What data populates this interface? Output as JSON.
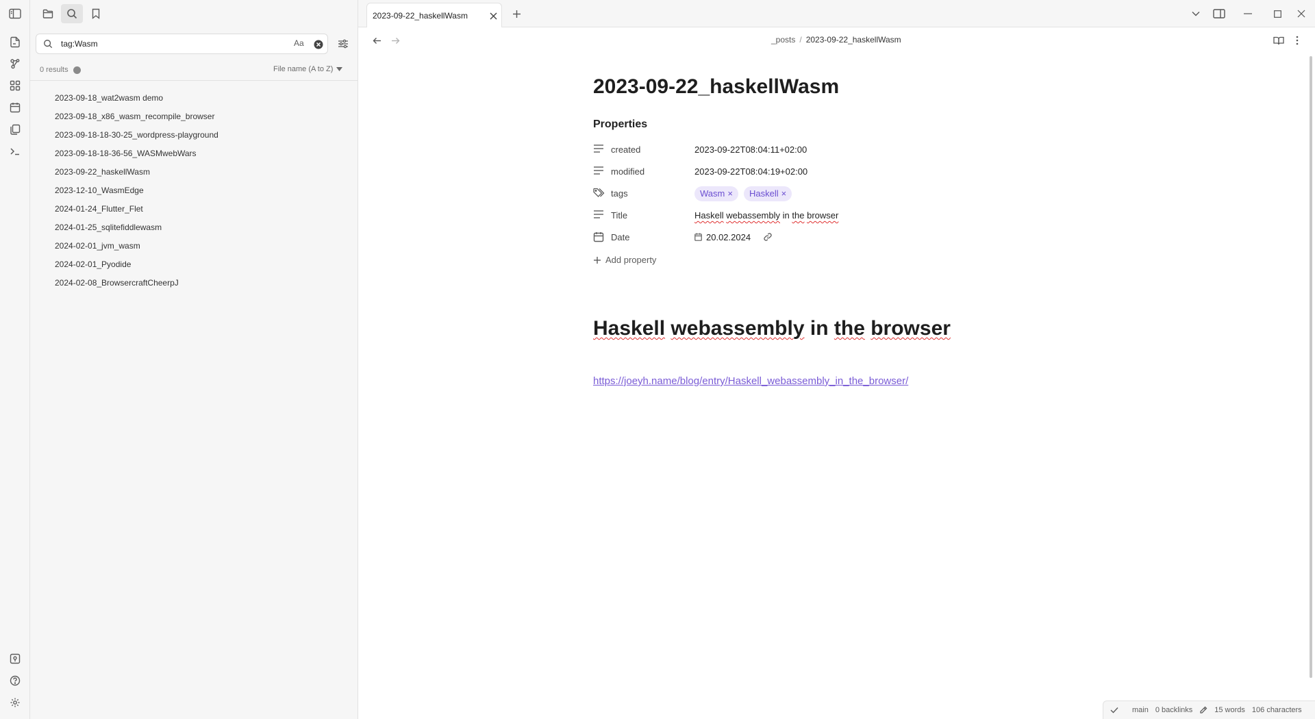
{
  "ribbon": {
    "icons": [
      "sidebar-toggle-icon",
      "new-note-icon",
      "graph-view-icon",
      "canvas-icon",
      "daily-note-icon",
      "templates-icon",
      "command-palette-icon"
    ],
    "bottom_icons": [
      "vault-switcher-icon",
      "help-icon",
      "settings-icon"
    ]
  },
  "sidebar": {
    "tabs": [
      "files-icon",
      "search-icon",
      "bookmarks-icon"
    ],
    "active_tab": "search",
    "search": {
      "query": "tag:Wasm",
      "match_case_label": "Aa"
    },
    "results_count": "0 results",
    "sort_label": "File name (A to Z)",
    "files": [
      "2023-09-18_wat2wasm demo",
      "2023-09-18_x86_wasm_recompile_browser",
      "2023-09-18-18-30-25_wordpress-playground",
      "2023-09-18-18-36-56_WASMwebWars",
      "2023-09-22_haskellWasm",
      "2023-12-10_WasmEdge",
      "2024-01-24_Flutter_Flet",
      "2024-01-25_sqlitefiddlewasm",
      "2024-02-01_jvm_wasm",
      "2024-02-01_Pyodide",
      "2024-02-08_BrowsercraftCheerpJ"
    ]
  },
  "tabbar": {
    "active_tab_title": "2023-09-22_haskellWasm"
  },
  "header": {
    "breadcrumb_folder": "_posts",
    "breadcrumb_separator": "/",
    "breadcrumb_file": "2023-09-22_haskellWasm"
  },
  "note": {
    "title": "2023-09-22_haskellWasm",
    "properties_heading": "Properties",
    "properties": {
      "created": {
        "key": "created",
        "value": "2023-09-22T08:04:11+02:00"
      },
      "modified": {
        "key": "modified",
        "value": "2023-09-22T08:04:19+02:00"
      },
      "tags": {
        "key": "tags",
        "values": [
          "Wasm",
          "Haskell"
        ],
        "remove_glyph": "×"
      },
      "title": {
        "key": "Title",
        "words": [
          "Haskell",
          "webassembly",
          "in",
          "the",
          "browser"
        ]
      },
      "date": {
        "key": "Date",
        "value": "20.02.2024"
      }
    },
    "add_property_label": "Add property",
    "heading": {
      "words": [
        "Haskell",
        "webassembly",
        "in",
        "the",
        "browser"
      ]
    },
    "link": "https://joeyh.name/blog/entry/Haskell_webassembly_in_the_browser/"
  },
  "statusbar": {
    "branch": "main",
    "backlinks": "0 backlinks",
    "words": "15 words",
    "characters": "106 characters"
  },
  "colors": {
    "accent": "#7a5cd6",
    "tag_bg": "#ece7fb",
    "tag_text": "#6b4fd1",
    "spellcheck": "#e03131",
    "sidebar_bg": "#f6f6f6"
  }
}
